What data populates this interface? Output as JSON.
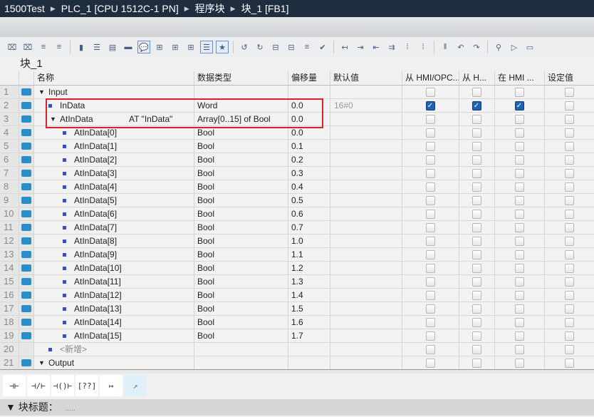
{
  "breadcrumb": [
    "1500Test",
    "PLC_1 [CPU 1512C-1 PN]",
    "程序块",
    "块_1 [FB1]"
  ],
  "block_name": "块_1",
  "columns": [
    "名称",
    "数据类型",
    "偏移量",
    "默认值",
    "从 HMI/OPC...",
    "从 H...",
    "在 HMI ...",
    "设定值"
  ],
  "rows": [
    {
      "n": "1",
      "name": "Input",
      "type": "",
      "off": "",
      "def": "",
      "lvl": 0,
      "exp": true,
      "hmi": [
        false,
        false,
        false
      ],
      "sp": false
    },
    {
      "n": "2",
      "name": "InData",
      "type": "Word",
      "off": "0.0",
      "def": "16#0",
      "lvl": 1,
      "dot": true,
      "hmi": [
        true,
        true,
        true
      ],
      "sp": false
    },
    {
      "n": "3",
      "name": "AtInData",
      "at": "AT \"InData\"",
      "type": "Array[0..15] of Bool",
      "off": "0.0",
      "def": "",
      "lvl": 1,
      "exp": true,
      "hmi": [
        false,
        false,
        false
      ],
      "sp": false
    },
    {
      "n": "4",
      "name": "AtInData[0]",
      "type": "Bool",
      "off": "0.0",
      "lvl": 2,
      "dot": true
    },
    {
      "n": "5",
      "name": "AtInData[1]",
      "type": "Bool",
      "off": "0.1",
      "lvl": 2,
      "dot": true
    },
    {
      "n": "6",
      "name": "AtInData[2]",
      "type": "Bool",
      "off": "0.2",
      "lvl": 2,
      "dot": true
    },
    {
      "n": "7",
      "name": "AtInData[3]",
      "type": "Bool",
      "off": "0.3",
      "lvl": 2,
      "dot": true
    },
    {
      "n": "8",
      "name": "AtInData[4]",
      "type": "Bool",
      "off": "0.4",
      "lvl": 2,
      "dot": true
    },
    {
      "n": "9",
      "name": "AtInData[5]",
      "type": "Bool",
      "off": "0.5",
      "lvl": 2,
      "dot": true
    },
    {
      "n": "10",
      "name": "AtInData[6]",
      "type": "Bool",
      "off": "0.6",
      "lvl": 2,
      "dot": true
    },
    {
      "n": "11",
      "name": "AtInData[7]",
      "type": "Bool",
      "off": "0.7",
      "lvl": 2,
      "dot": true
    },
    {
      "n": "12",
      "name": "AtInData[8]",
      "type": "Bool",
      "off": "1.0",
      "lvl": 2,
      "dot": true
    },
    {
      "n": "13",
      "name": "AtInData[9]",
      "type": "Bool",
      "off": "1.1",
      "lvl": 2,
      "dot": true
    },
    {
      "n": "14",
      "name": "AtInData[10]",
      "type": "Bool",
      "off": "1.2",
      "lvl": 2,
      "dot": true
    },
    {
      "n": "15",
      "name": "AtInData[11]",
      "type": "Bool",
      "off": "1.3",
      "lvl": 2,
      "dot": true
    },
    {
      "n": "16",
      "name": "AtInData[12]",
      "type": "Bool",
      "off": "1.4",
      "lvl": 2,
      "dot": true
    },
    {
      "n": "17",
      "name": "AtInData[13]",
      "type": "Bool",
      "off": "1.5",
      "lvl": 2,
      "dot": true
    },
    {
      "n": "18",
      "name": "AtInData[14]",
      "type": "Bool",
      "off": "1.6",
      "lvl": 2,
      "dot": true
    },
    {
      "n": "19",
      "name": "AtInData[15]",
      "type": "Bool",
      "off": "1.7",
      "lvl": 2,
      "dot": true
    },
    {
      "n": "20",
      "name": "<新增>",
      "type": "",
      "off": "",
      "lvl": 1,
      "dot": true,
      "noicon": true,
      "add": true
    },
    {
      "n": "21",
      "name": "Output",
      "type": "",
      "off": "",
      "lvl": 0,
      "exp": true
    }
  ],
  "palette": [
    "⊣⊢",
    "⊣/⊢",
    "⊣()⊢",
    "[??]",
    "↦",
    "↗"
  ],
  "footer": {
    "label": "块标题：",
    "placeholder": "....."
  }
}
